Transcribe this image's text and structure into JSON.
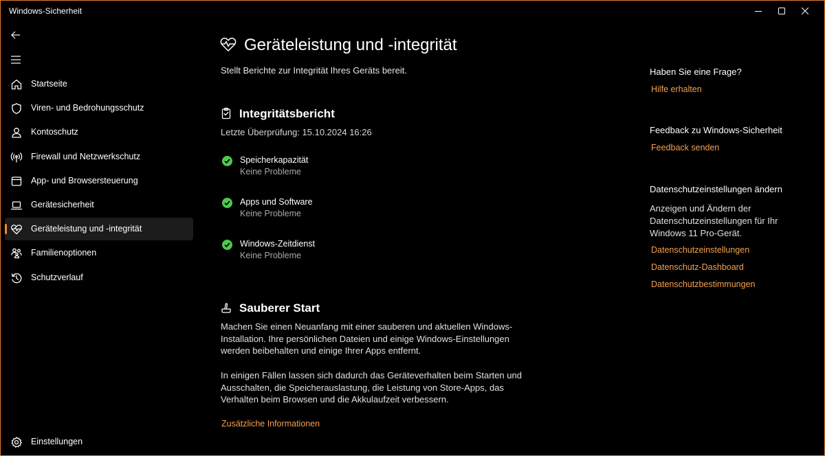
{
  "window": {
    "title": "Windows-Sicherheit",
    "accent": "#f28b2c",
    "link_color": "#f5a04d",
    "border_color": "#e07a2e"
  },
  "sidebar": {
    "items": [
      {
        "label": "Startseite",
        "icon": "home-icon"
      },
      {
        "label": "Viren- und Bedrohungsschutz",
        "icon": "shield-icon"
      },
      {
        "label": "Kontoschutz",
        "icon": "person-icon"
      },
      {
        "label": "Firewall und Netzwerkschutz",
        "icon": "antenna-icon"
      },
      {
        "label": "App- und Browsersteuerung",
        "icon": "browser-window-icon"
      },
      {
        "label": "Gerätesicherheit",
        "icon": "laptop-icon"
      },
      {
        "label": "Geräteleistung und -integrität",
        "icon": "heart-pulse-icon",
        "active": true
      },
      {
        "label": "Familienoptionen",
        "icon": "family-icon"
      },
      {
        "label": "Schutzverlauf",
        "icon": "history-icon"
      }
    ],
    "settings_label": "Einstellungen"
  },
  "main": {
    "title": "Geräteleistung und -integrität",
    "subtitle": "Stellt Berichte zur Integrität Ihres Geräts bereit.",
    "report": {
      "title": "Integritätsbericht",
      "last_check": "Letzte Überprüfung: 15.10.2024 16:26",
      "items": [
        {
          "name": "Speicherkapazität",
          "status": "Keine Probleme"
        },
        {
          "name": "Apps und Software",
          "status": "Keine Probleme"
        },
        {
          "name": "Windows-Zeitdienst",
          "status": "Keine Probleme"
        }
      ]
    },
    "fresh_start": {
      "title": "Sauberer Start",
      "para1": "Machen Sie einen Neuanfang mit einer sauberen und aktuellen Windows-Installation. Ihre persönlichen Dateien und einige Windows-Einstellungen werden beibehalten und einige Ihrer Apps entfernt.",
      "para2": "In einigen Fällen lassen sich dadurch das Geräteverhalten beim Starten und Ausschalten, die Speicherauslastung, die Leistung von Store-Apps, das Verhalten beim Browsen und die Akkulaufzeit verbessern.",
      "link": "Zusätzliche Informationen"
    }
  },
  "right": {
    "question": {
      "heading": "Haben Sie eine Frage?",
      "link": "Hilfe erhalten"
    },
    "feedback": {
      "heading": "Feedback zu Windows-Sicherheit",
      "link": "Feedback senden"
    },
    "privacy": {
      "heading": "Datenschutzeinstellungen ändern",
      "text": "Anzeigen und Ändern der Datenschutzeinstellungen für Ihr Windows 11 Pro-Gerät.",
      "links": [
        "Datenschutzeinstellungen",
        "Datenschutz-Dashboard",
        "Datenschutzbestimmungen"
      ]
    }
  }
}
